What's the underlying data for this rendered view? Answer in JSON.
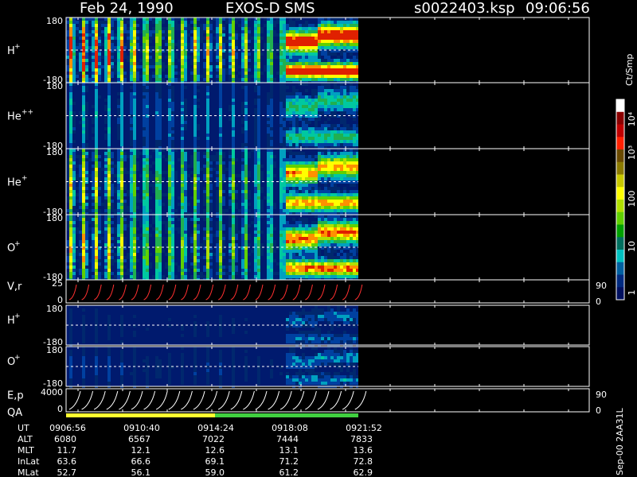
{
  "header": {
    "date": "Feb 24, 1990",
    "instrument": "EXOS-D SMS",
    "file": "s0022403.ksp",
    "time": "09:06:56"
  },
  "chart_data": {
    "type": "heatmap",
    "panels": [
      {
        "label": "H",
        "sup": "+",
        "ymax": "180",
        "ymin": "-180",
        "kind": "pitch",
        "intensity": 0.9
      },
      {
        "label": "He",
        "sup": "++",
        "ymax": "180",
        "ymin": "-180",
        "kind": "pitch",
        "intensity": 0.35
      },
      {
        "label": "He",
        "sup": "+",
        "ymax": "180",
        "ymin": "-180",
        "kind": "pitch",
        "intensity": 0.7
      },
      {
        "label": "O",
        "sup": "+",
        "ymax": "180",
        "ymin": "-180",
        "kind": "pitch",
        "intensity": 0.75
      },
      {
        "label": "V,r",
        "sup": "",
        "ymax": "25",
        "ymin": "0",
        "kind": "line-red",
        "rmax": "90",
        "rmin": "0"
      },
      {
        "label": "H",
        "sup": "+",
        "ymax": "180",
        "ymin": "-180",
        "kind": "pitch",
        "intensity": 0.15
      },
      {
        "label": "O",
        "sup": "+",
        "ymax": "180",
        "ymin": "-180",
        "kind": "pitch",
        "intensity": 0.2
      },
      {
        "label": "E,p",
        "sup": "",
        "ymax": "4000",
        "ymin": "0",
        "kind": "line-white",
        "rmax": "90",
        "rmin": "0"
      }
    ],
    "qa_label": "QA",
    "colorbar": {
      "unit": "Ct/Smp",
      "ticks": [
        "10⁴",
        "10³",
        "100",
        "10",
        "1"
      ],
      "colors": [
        "#ffffff",
        "#8b0000",
        "#c00000",
        "#ff2000",
        "#6b4a00",
        "#8b7a00",
        "#c8c800",
        "#ffff00",
        "#b0e000",
        "#60d000",
        "#00a000",
        "#007060",
        "#00c0c0",
        "#0060a0",
        "#002a80",
        "#001060"
      ]
    },
    "time_axis": {
      "rows": [
        {
          "name": "UT",
          "values": [
            "0906:56",
            "0910:40",
            "0914:24",
            "0918:08",
            "0921:52"
          ]
        },
        {
          "name": "ALT",
          "values": [
            "6080",
            "6567",
            "7022",
            "7444",
            "7833"
          ]
        },
        {
          "name": "MLT",
          "values": [
            "11.7",
            "12.1",
            "12.6",
            "13.1",
            "13.6"
          ]
        },
        {
          "name": "InLat",
          "values": [
            "63.6",
            "66.6",
            "69.1",
            "71.2",
            "72.8"
          ]
        },
        {
          "name": "MLat",
          "values": [
            "52.7",
            "56.1",
            "59.0",
            "61.2",
            "62.9"
          ]
        }
      ]
    },
    "version": "Sep-00 2AA31L"
  }
}
